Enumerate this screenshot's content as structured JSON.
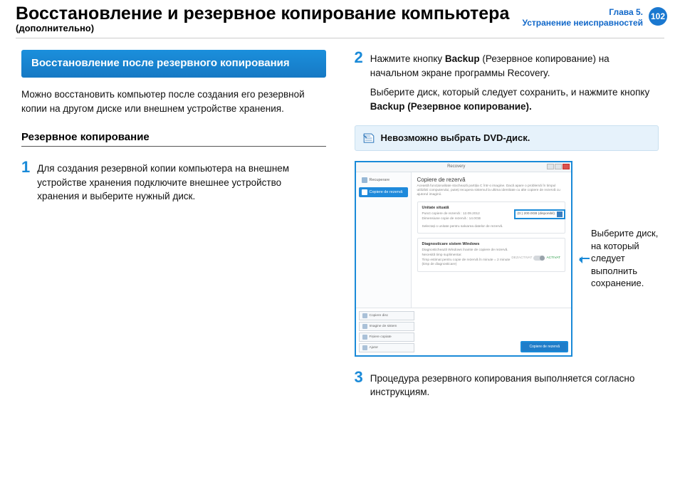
{
  "header": {
    "title": "Восстановление и резервное копирование компьютера",
    "subtitle": "(дополнительно)",
    "chapter_line1": "Глава 5.",
    "chapter_line2": "Устранение неисправностей",
    "page_number": "102"
  },
  "left": {
    "callout": "Восстановление после резервного копирования",
    "intro": "Можно восстановить компьютер после создания его резервной копии на другом диске или внешнем устройстве хранения.",
    "section_title": "Резервное копирование",
    "step1_num": "1",
    "step1_text": "Для создания резервной копии компьютера на внешнем устройстве хранения подключите внешнее устройство хранения и выберите нужный диск."
  },
  "right": {
    "step2_num": "2",
    "step2_text_a": "Нажмите кнопку ",
    "step2_text_b": "Backup",
    "step2_text_c": " (Резервное копирование) на начальном экране программы Recovery.",
    "step2_text_d": "Выберите диск, который следует сохранить, и нажмите кнопку ",
    "step2_text_e": "Backup (Резервное копирование).",
    "note": "Невозможно выбрать DVD-диск.",
    "callout_disk": "Выберите диск, на который следует выполнить сохранение.",
    "step3_num": "3",
    "step3_text": "Процедура резервного копирования выполняется согласно инструкциям."
  },
  "app": {
    "title": "Recovery",
    "side_item1": "Recuperare",
    "side_item2": "Copiere de rezervă",
    "main_title": "Copiere de rezervă",
    "main_desc": "Această funcționalitate stochează partiția C într-o imagine. Dacă apare o problemă în timpul utilizării computerului, puteți recupera sistemul la ultima identitate cu alte copiere de rezervă cu ajutorul imaginii.",
    "panel1_title": "Unitate situată",
    "panel1_line1": "Punct copiere de rezervă : 12.09.2012",
    "panel1_line2": "Dimensiune copie de rezervă : 14.0GB",
    "panel1_line3": "Selectați o unitate pentru salvarea datelor de rezervă.",
    "disk_label": "(D:) 200.0GB (disponibil)",
    "panel2_title": "Diagnosticare sistem Windows",
    "panel2_line1": "Diagnostichează Windows înainte de copiere de rezervă.",
    "panel2_line2": "Necesită timp suplimentar.",
    "panel2_line3": "Timp estimat pentru copie de rezervă în minute = 2 minute (timp de diagnosticare)",
    "toggle_off": "DEZACTIVAT",
    "toggle_on": "ACTIVAT",
    "bottom_btn1": "Copiere disc",
    "bottom_btn2": "Imagine de sistem",
    "bottom_btn3": "Fișiere copiate",
    "bottom_btn4": "Ajutor",
    "primary_btn": "Copiere de rezervă"
  }
}
